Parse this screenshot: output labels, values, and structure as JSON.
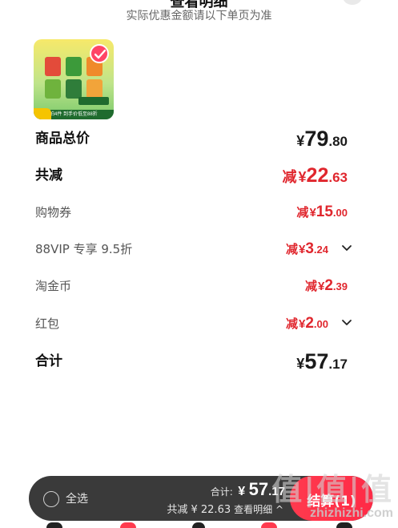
{
  "header": {
    "title": "查看明细",
    "subtitle": "实际优惠金额请以下单页为准"
  },
  "product": {
    "image_text": "拍4件 到手价低至88折",
    "selected": true
  },
  "summary": {
    "goods_total": {
      "label": "商品总价",
      "currency": "¥",
      "int": "79",
      "dec": ".80"
    },
    "total_discount": {
      "label": "共减",
      "prefix": "减",
      "currency": "¥",
      "int": "22",
      "dec": ".63"
    },
    "coupon": {
      "label": "购物券",
      "prefix": "减",
      "currency": "¥",
      "int": "15",
      "dec": ".00"
    },
    "vip": {
      "label": "88VIP 专享 9.5折",
      "prefix": "减",
      "currency": "¥",
      "int": "3",
      "dec": ".24"
    },
    "taojinbi": {
      "label": "淘金币",
      "prefix": "减",
      "currency": "¥",
      "int": "2",
      "dec": ".39"
    },
    "red_packet": {
      "label": "红包",
      "prefix": "减",
      "currency": "¥",
      "int": "2",
      "dec": ".00"
    },
    "total": {
      "label": "合计",
      "currency": "¥",
      "int": "57",
      "dec": ".17"
    }
  },
  "bottom_bar": {
    "select_all_label": "全选",
    "total_label": "合计:",
    "total_currency": "¥",
    "total_int": "57",
    "total_dec": ".17",
    "saving_text": "共减 ¥ 22.63",
    "detail_label": "查看明细 ^",
    "checkout_label": "结算(1)"
  },
  "watermark": {
    "text": "值|值|值",
    "url": "zhizhizhi.com"
  },
  "colors": {
    "accent_red": "#e0262d",
    "checkout_red": "#ff2a46",
    "bar_dark": "#3a3a3a"
  }
}
